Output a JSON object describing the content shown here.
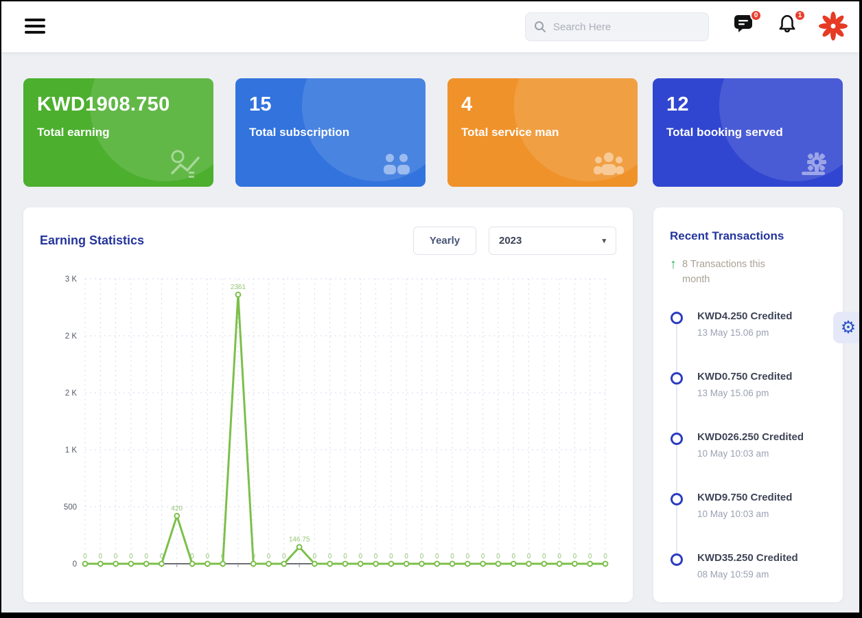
{
  "header": {
    "search_placeholder": "Search Here",
    "message_badge": "0",
    "notification_badge": "1"
  },
  "cards": [
    {
      "value": "KWD1908.750",
      "label": "Total earning",
      "color": "#4caf2e",
      "icon": "earning-chart-icon"
    },
    {
      "value": "15",
      "label": "Total subscription",
      "color": "#3273dd",
      "icon": "subscription-people-icon"
    },
    {
      "value": "4",
      "label": "Total service man",
      "color": "#f0922a",
      "icon": "service-man-icon"
    },
    {
      "value": "12",
      "label": "Total booking served",
      "color": "#3146d0",
      "icon": "booking-gear-icon"
    }
  ],
  "earning": {
    "title": "Earning Statistics",
    "period_button": "Yearly",
    "year_selected": "2023",
    "caret": "▾"
  },
  "chart_data": {
    "type": "line",
    "title": "Earning Statistics",
    "x": [
      1,
      2,
      3,
      4,
      5,
      6,
      7,
      8,
      9,
      10,
      11,
      12,
      13,
      14,
      15,
      16,
      17,
      18,
      19,
      20,
      21,
      22,
      23,
      24,
      25,
      26,
      27,
      28,
      29,
      30,
      31,
      32,
      33,
      34,
      35
    ],
    "values": [
      0,
      0,
      0,
      0,
      0,
      0,
      420,
      0,
      0,
      0,
      2361,
      0,
      0,
      0,
      146.75,
      0,
      0,
      0,
      0,
      0,
      0,
      0,
      0,
      0,
      0,
      0,
      0,
      0,
      0,
      0,
      0,
      0,
      0,
      0,
      0
    ],
    "y_ticks": [
      {
        "value": 0,
        "label": "0"
      },
      {
        "value": 500,
        "label": "500"
      },
      {
        "value": 1000,
        "label": "1 K"
      },
      {
        "value": 1500,
        "label": "2 K"
      },
      {
        "value": 2000,
        "label": "2 K"
      },
      {
        "value": 2500,
        "label": "3 K"
      }
    ],
    "ylim": [
      0,
      2500
    ],
    "line_color": "#7cbf4a",
    "grid": "dashed",
    "legend": "none"
  },
  "transactions": {
    "title": "Recent Transactions",
    "arrow_glyph": "↑",
    "summary": "8 Transactions this month",
    "items": [
      {
        "amount": "KWD4.250 Credited",
        "time": "13 May 15.06 pm"
      },
      {
        "amount": "KWD0.750 Credited",
        "time": "13 May 15.06 pm"
      },
      {
        "amount": "KWD026.250 Credited",
        "time": "10 May 10:03 am"
      },
      {
        "amount": "KWD9.750 Credited",
        "time": "10 May 10:03 am"
      },
      {
        "amount": "KWD35.250 Credited",
        "time": "08 May 10:59 am"
      }
    ]
  },
  "settings": {
    "gear_glyph": "⚙"
  },
  "colors": {
    "accent_navy": "#24349c",
    "badge_red": "#e8402f",
    "chart_green": "#7cbf4a",
    "timeline_blue": "#2b3cc0"
  }
}
